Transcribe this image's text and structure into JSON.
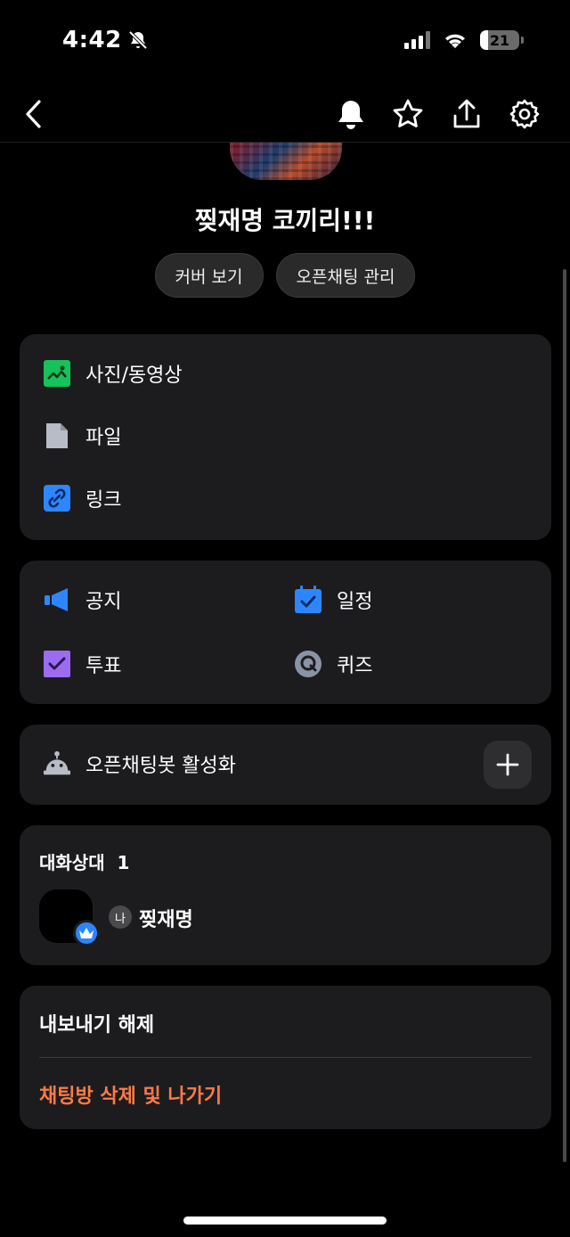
{
  "status_bar": {
    "time": "4:42",
    "battery": "21",
    "battery_level": 0.21
  },
  "nav": {
    "icons": [
      "back-icon",
      "bell-icon",
      "star-icon",
      "share-icon",
      "gear-icon"
    ]
  },
  "room": {
    "title": "찢재명 코끼리!!!"
  },
  "actions": {
    "view_cover": "커버 보기",
    "manage": "오픈채팅 관리"
  },
  "media": {
    "photos": "사진/동영상",
    "files": "파일",
    "links": "링크"
  },
  "tools": {
    "notice": "공지",
    "schedule": "일정",
    "vote": "투표",
    "quiz": "퀴즈"
  },
  "bot": {
    "label": "오픈채팅봇 활성화"
  },
  "members": {
    "header": "대화상대  1",
    "me_badge": "나",
    "name": "찢재명"
  },
  "footer": {
    "export": "내보내기 해제",
    "leave": "채팅방 삭제 및 나가기",
    "leave_color": "#ff7a45"
  },
  "colors": {
    "card": "#1c1c1e",
    "accent_blue": "#2d86ff",
    "green": "#16c25a",
    "purple": "#9b6cf0"
  }
}
